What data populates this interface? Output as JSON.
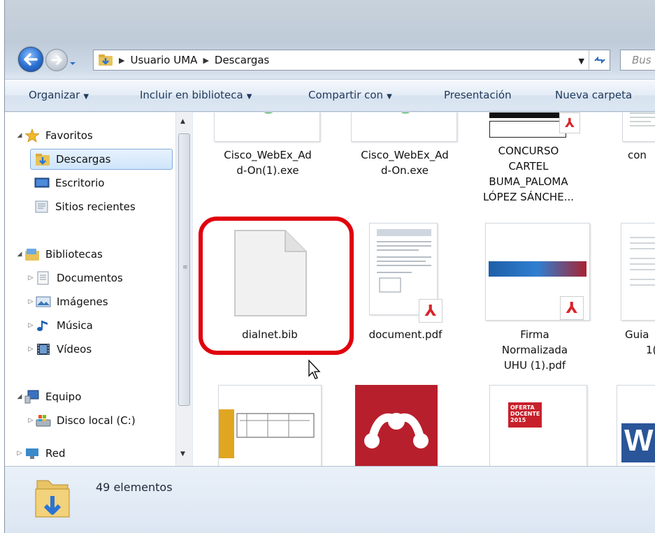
{
  "address": {
    "breadcrumbs": [
      "Usuario UMA",
      "Descargas"
    ],
    "search_placeholder": "Bus"
  },
  "toolbar": {
    "organize": "Organizar",
    "include_library": "Incluir en biblioteca",
    "share": "Compartir con",
    "slideshow": "Presentación",
    "new_folder": "Nueva carpeta"
  },
  "nav": {
    "favorites": "Favoritos",
    "downloads": "Descargas",
    "desktop": "Escritorio",
    "recent": "Sitios recientes",
    "libraries": "Bibliotecas",
    "documents": "Documentos",
    "pictures": "Imágenes",
    "music": "Música",
    "videos": "Vídeos",
    "computer": "Equipo",
    "local_disk": "Disco local (C:)",
    "network": "Red"
  },
  "files": [
    {
      "name1": "Cisco_WebEx_Ad",
      "name2": "d-On(1).exe"
    },
    {
      "name1": "Cisco_WebEx_Ad",
      "name2": "d-On.exe"
    },
    {
      "name1": "CONCURSO",
      "name2": "CARTEL",
      "name3": "BUMA_PALOMA",
      "name4": "LÓPEZ SÁNCHE..."
    },
    {
      "name1": "con"
    },
    {
      "name1": "dialnet.bib"
    },
    {
      "name1": "document.pdf"
    },
    {
      "name1": "Firma",
      "name2": "Normalizada",
      "name3": "UHU (1).pdf"
    },
    {
      "name1": "Guia",
      "name2": "1("
    }
  ],
  "thumb_text": {
    "oferta": "OFERTA",
    "docente": "DOCENTE",
    "year": "2015"
  },
  "status": {
    "count": "49 elementos"
  },
  "colors": {
    "highlight": "#e0000d",
    "pdf_red": "#d8232a",
    "mendeley_red": "#b81f2c"
  }
}
